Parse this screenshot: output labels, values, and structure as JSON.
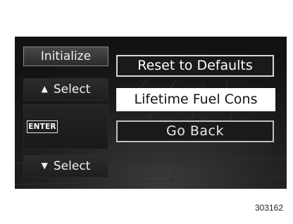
{
  "left_panel": {
    "initialize_label": "Initialize",
    "select_up_label": "Select",
    "select_up_icon": "triangle-up-icon",
    "enter_label": "ENTER",
    "select_down_label": "Select",
    "select_down_icon": "triangle-down-icon"
  },
  "menu": {
    "items": [
      {
        "label": "Reset to Defaults",
        "selected": false
      },
      {
        "label": "Lifetime Fuel Cons",
        "selected": true
      },
      {
        "label": "Go Back",
        "selected": false
      }
    ]
  },
  "figure_number": "303162",
  "colors": {
    "screen_background": "#161616",
    "text": "#f2f2f2",
    "highlight": "#ffffff"
  }
}
